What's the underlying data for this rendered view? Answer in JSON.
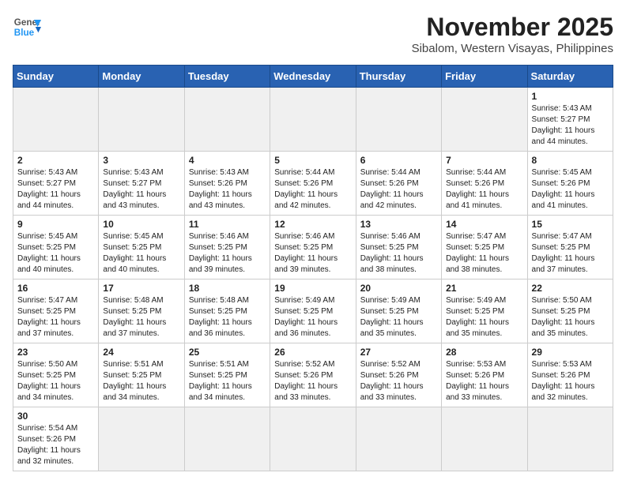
{
  "header": {
    "logo_general": "General",
    "logo_blue": "Blue",
    "month_title": "November 2025",
    "location": "Sibalom, Western Visayas, Philippines"
  },
  "weekdays": [
    "Sunday",
    "Monday",
    "Tuesday",
    "Wednesday",
    "Thursday",
    "Friday",
    "Saturday"
  ],
  "weeks": [
    [
      {
        "day": "",
        "info": ""
      },
      {
        "day": "",
        "info": ""
      },
      {
        "day": "",
        "info": ""
      },
      {
        "day": "",
        "info": ""
      },
      {
        "day": "",
        "info": ""
      },
      {
        "day": "",
        "info": ""
      },
      {
        "day": "1",
        "info": "Sunrise: 5:43 AM\nSunset: 5:27 PM\nDaylight: 11 hours\nand 44 minutes."
      }
    ],
    [
      {
        "day": "2",
        "info": "Sunrise: 5:43 AM\nSunset: 5:27 PM\nDaylight: 11 hours\nand 44 minutes."
      },
      {
        "day": "3",
        "info": "Sunrise: 5:43 AM\nSunset: 5:27 PM\nDaylight: 11 hours\nand 43 minutes."
      },
      {
        "day": "4",
        "info": "Sunrise: 5:43 AM\nSunset: 5:26 PM\nDaylight: 11 hours\nand 43 minutes."
      },
      {
        "day": "5",
        "info": "Sunrise: 5:44 AM\nSunset: 5:26 PM\nDaylight: 11 hours\nand 42 minutes."
      },
      {
        "day": "6",
        "info": "Sunrise: 5:44 AM\nSunset: 5:26 PM\nDaylight: 11 hours\nand 42 minutes."
      },
      {
        "day": "7",
        "info": "Sunrise: 5:44 AM\nSunset: 5:26 PM\nDaylight: 11 hours\nand 41 minutes."
      },
      {
        "day": "8",
        "info": "Sunrise: 5:45 AM\nSunset: 5:26 PM\nDaylight: 11 hours\nand 41 minutes."
      }
    ],
    [
      {
        "day": "9",
        "info": "Sunrise: 5:45 AM\nSunset: 5:25 PM\nDaylight: 11 hours\nand 40 minutes."
      },
      {
        "day": "10",
        "info": "Sunrise: 5:45 AM\nSunset: 5:25 PM\nDaylight: 11 hours\nand 40 minutes."
      },
      {
        "day": "11",
        "info": "Sunrise: 5:46 AM\nSunset: 5:25 PM\nDaylight: 11 hours\nand 39 minutes."
      },
      {
        "day": "12",
        "info": "Sunrise: 5:46 AM\nSunset: 5:25 PM\nDaylight: 11 hours\nand 39 minutes."
      },
      {
        "day": "13",
        "info": "Sunrise: 5:46 AM\nSunset: 5:25 PM\nDaylight: 11 hours\nand 38 minutes."
      },
      {
        "day": "14",
        "info": "Sunrise: 5:47 AM\nSunset: 5:25 PM\nDaylight: 11 hours\nand 38 minutes."
      },
      {
        "day": "15",
        "info": "Sunrise: 5:47 AM\nSunset: 5:25 PM\nDaylight: 11 hours\nand 37 minutes."
      }
    ],
    [
      {
        "day": "16",
        "info": "Sunrise: 5:47 AM\nSunset: 5:25 PM\nDaylight: 11 hours\nand 37 minutes."
      },
      {
        "day": "17",
        "info": "Sunrise: 5:48 AM\nSunset: 5:25 PM\nDaylight: 11 hours\nand 37 minutes."
      },
      {
        "day": "18",
        "info": "Sunrise: 5:48 AM\nSunset: 5:25 PM\nDaylight: 11 hours\nand 36 minutes."
      },
      {
        "day": "19",
        "info": "Sunrise: 5:49 AM\nSunset: 5:25 PM\nDaylight: 11 hours\nand 36 minutes."
      },
      {
        "day": "20",
        "info": "Sunrise: 5:49 AM\nSunset: 5:25 PM\nDaylight: 11 hours\nand 35 minutes."
      },
      {
        "day": "21",
        "info": "Sunrise: 5:49 AM\nSunset: 5:25 PM\nDaylight: 11 hours\nand 35 minutes."
      },
      {
        "day": "22",
        "info": "Sunrise: 5:50 AM\nSunset: 5:25 PM\nDaylight: 11 hours\nand 35 minutes."
      }
    ],
    [
      {
        "day": "23",
        "info": "Sunrise: 5:50 AM\nSunset: 5:25 PM\nDaylight: 11 hours\nand 34 minutes."
      },
      {
        "day": "24",
        "info": "Sunrise: 5:51 AM\nSunset: 5:25 PM\nDaylight: 11 hours\nand 34 minutes."
      },
      {
        "day": "25",
        "info": "Sunrise: 5:51 AM\nSunset: 5:25 PM\nDaylight: 11 hours\nand 34 minutes."
      },
      {
        "day": "26",
        "info": "Sunrise: 5:52 AM\nSunset: 5:26 PM\nDaylight: 11 hours\nand 33 minutes."
      },
      {
        "day": "27",
        "info": "Sunrise: 5:52 AM\nSunset: 5:26 PM\nDaylight: 11 hours\nand 33 minutes."
      },
      {
        "day": "28",
        "info": "Sunrise: 5:53 AM\nSunset: 5:26 PM\nDaylight: 11 hours\nand 33 minutes."
      },
      {
        "day": "29",
        "info": "Sunrise: 5:53 AM\nSunset: 5:26 PM\nDaylight: 11 hours\nand 32 minutes."
      }
    ],
    [
      {
        "day": "30",
        "info": "Sunrise: 5:54 AM\nSunset: 5:26 PM\nDaylight: 11 hours\nand 32 minutes."
      },
      {
        "day": "",
        "info": ""
      },
      {
        "day": "",
        "info": ""
      },
      {
        "day": "",
        "info": ""
      },
      {
        "day": "",
        "info": ""
      },
      {
        "day": "",
        "info": ""
      },
      {
        "day": "",
        "info": ""
      }
    ]
  ]
}
